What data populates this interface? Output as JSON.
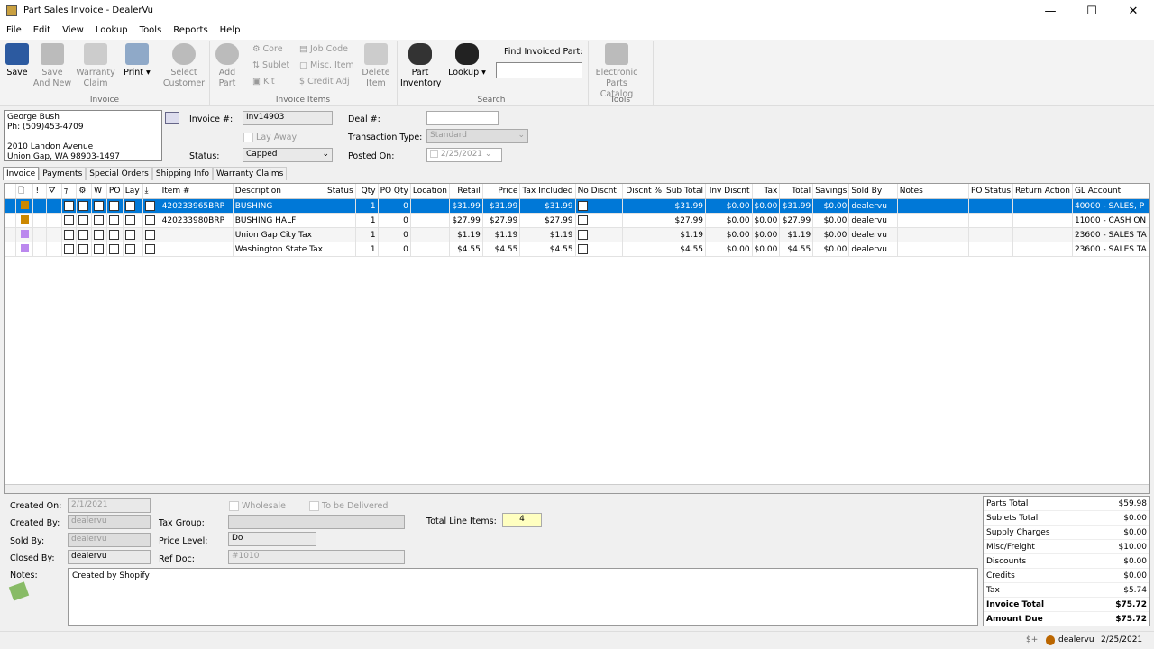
{
  "window": {
    "title": "Part Sales Invoice - DealerVu",
    "min": "—",
    "max": "☐",
    "close": "✕"
  },
  "menu": [
    "File",
    "Edit",
    "View",
    "Lookup",
    "Tools",
    "Reports",
    "Help"
  ],
  "ribbon": {
    "invoice": {
      "group": "Invoice",
      "save": "Save",
      "save_new_1": "Save",
      "save_new_2": "And New",
      "warranty_1": "Warranty",
      "warranty_2": "Claim",
      "print": "Print",
      "select_1": "Select",
      "select_2": "Customer"
    },
    "items": {
      "group": "Invoice Items",
      "add_1": "Add",
      "add_2": "Part",
      "core": "Core",
      "sublet": "Sublet",
      "kit": "Kit",
      "job_code": "Job Code",
      "misc": "Misc. Item",
      "credit": "Credit Adj",
      "delete_1": "Delete",
      "delete_2": "Item"
    },
    "search": {
      "group": "Search",
      "inv_1": "Part",
      "inv_2": "Inventory",
      "lookup": "Lookup",
      "find_label": "Find Invoiced Part:",
      "find_value": ""
    },
    "tools": {
      "group": "Tools",
      "epc_1": "Electronic",
      "epc_2": "Parts Catalog"
    }
  },
  "customer": {
    "name": "George Bush",
    "phone": "Ph: (509)453-4709",
    "addr1": "2010 Landon Avenue",
    "addr2": "Union Gap, WA 98903-1497"
  },
  "header": {
    "invoice_label": "Invoice #:",
    "invoice": "Inv14903",
    "layaway": "Lay Away",
    "status_label": "Status:",
    "status": "Capped",
    "deal_label": "Deal #:",
    "deal": "",
    "trans_label": "Transaction Type:",
    "trans": "Standard",
    "posted_label": "Posted On:",
    "posted": "2/25/2021"
  },
  "tabs": [
    "Invoice",
    "Payments",
    "Special Orders",
    "Shipping Info",
    "Warranty Claims"
  ],
  "columns": [
    "",
    "🗋",
    "!",
    "⛛",
    "⁊",
    "⚙",
    "W",
    "PO",
    "Lay",
    "⤓",
    "Item #",
    "Description",
    "Status",
    "Qty",
    "PO Qty",
    "Location",
    "Retail",
    "Price",
    "Tax Included",
    "No Discnt",
    "Discnt %",
    "Sub Total",
    "Inv Discnt",
    "Tax",
    "Total",
    "Savings",
    "Sold By",
    "Notes",
    "PO Status",
    "Return Action",
    "GL Account"
  ],
  "rows": [
    {
      "icon": "part",
      "item": "420233965BRP",
      "desc": "BUSHING",
      "qty": "1",
      "poqty": "0",
      "retail": "$31.99",
      "price": "$31.99",
      "taxinc": "$31.99",
      "sub": "$31.99",
      "invd": "$0.00",
      "tax": "$0.00",
      "total": "$31.99",
      "sav": "$0.00",
      "sold": "dealervu",
      "gl": "40000 - SALES, P"
    },
    {
      "icon": "part",
      "item": "420233980BRP",
      "desc": "BUSHING HALF",
      "qty": "1",
      "poqty": "0",
      "retail": "$27.99",
      "price": "$27.99",
      "taxinc": "$27.99",
      "sub": "$27.99",
      "invd": "$0.00",
      "tax": "$0.00",
      "total": "$27.99",
      "sav": "$0.00",
      "sold": "dealervu",
      "gl": "11000 - CASH ON"
    },
    {
      "icon": "tax",
      "item": "",
      "desc": "Union Gap City Tax",
      "qty": "1",
      "poqty": "0",
      "retail": "$1.19",
      "price": "$1.19",
      "taxinc": "$1.19",
      "sub": "$1.19",
      "invd": "$0.00",
      "tax": "$0.00",
      "total": "$1.19",
      "sav": "$0.00",
      "sold": "dealervu",
      "gl": "23600 - SALES TA"
    },
    {
      "icon": "tax",
      "item": "",
      "desc": "Washington State Tax",
      "qty": "1",
      "poqty": "0",
      "retail": "$4.55",
      "price": "$4.55",
      "taxinc": "$4.55",
      "sub": "$4.55",
      "invd": "$0.00",
      "tax": "$0.00",
      "total": "$4.55",
      "sav": "$0.00",
      "sold": "dealervu",
      "gl": "23600 - SALES TA"
    }
  ],
  "footer": {
    "created_on_label": "Created On:",
    "created_on": "2/1/2021",
    "created_by_label": "Created By:",
    "created_by": "dealervu",
    "sold_by_label": "Sold By:",
    "sold_by": "dealervu",
    "closed_by_label": "Closed By:",
    "closed_by": "dealervu",
    "notes_label": "Notes:",
    "notes": "Created by Shopify",
    "wholesale": "Wholesale",
    "delivered": "To be Delivered",
    "tax_group_label": "Tax Group:",
    "tax_group": "",
    "price_level_label": "Price Level:",
    "price_level": "Do",
    "ref_doc_label": "Ref Doc:",
    "ref_doc": "#1010",
    "line_items_label": "Total Line Items:",
    "line_items": "4"
  },
  "totals": [
    [
      "Parts Total",
      "$59.98"
    ],
    [
      "Sublets Total",
      "$0.00"
    ],
    [
      "Supply Charges",
      "$0.00"
    ],
    [
      "Misc/Freight",
      "$10.00"
    ],
    [
      "Discounts",
      "$0.00"
    ],
    [
      "Credits",
      "$0.00"
    ],
    [
      "Tax",
      "$5.74"
    ],
    [
      "Invoice Total",
      "$75.72"
    ],
    [
      "Amount Due",
      "$75.72"
    ]
  ],
  "statusbar": {
    "user": "dealervu",
    "date": "2/25/2021"
  },
  "colors": {
    "selection": "#0078d7",
    "save_icon": "#2c5aa0",
    "line_items_bg": "#ffffc0"
  }
}
